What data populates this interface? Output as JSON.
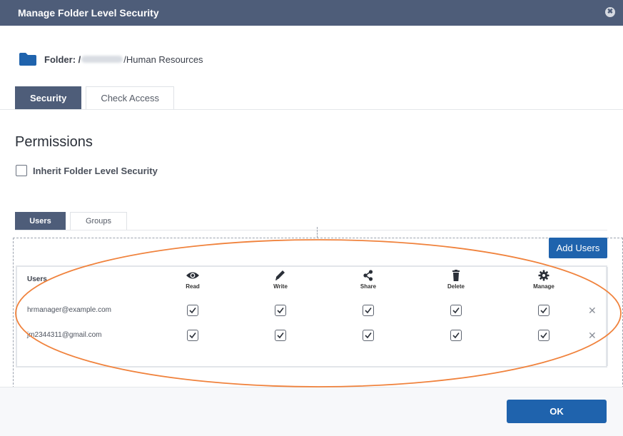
{
  "dialog": {
    "title": "Manage Folder Level Security",
    "close_symbol": "✖"
  },
  "folder": {
    "label": "Folder: /",
    "path_suffix": "/Human Resources",
    "icon": "folder-icon",
    "icon_color": "#1f63ad"
  },
  "tabs": {
    "security": "Security",
    "check_access": "Check Access"
  },
  "permissions": {
    "title": "Permissions",
    "inherit_label": "Inherit Folder Level Security",
    "inherit_checked": false
  },
  "subtabs": {
    "users": "Users",
    "groups": "Groups"
  },
  "add_users_label": "Add Users",
  "grid": {
    "users_header": "Users",
    "columns": [
      {
        "label": "Read",
        "icon": "eye-icon"
      },
      {
        "label": "Write",
        "icon": "pencil-icon"
      },
      {
        "label": "Share",
        "icon": "share-icon"
      },
      {
        "label": "Delete",
        "icon": "trash-icon"
      },
      {
        "label": "Manage",
        "icon": "gear-icon"
      }
    ],
    "rows": [
      {
        "email": "hrmanager@example.com",
        "read": true,
        "write": true,
        "share": true,
        "delete": true,
        "manage": true
      },
      {
        "email": "jm2344311@gmail.com",
        "read": true,
        "write": true,
        "share": true,
        "delete": true,
        "manage": true
      }
    ]
  },
  "remove_symbol": "✕",
  "ok_label": "OK",
  "colors": {
    "header_bg": "#4e5d79",
    "primary": "#1f63ad",
    "annotation": "#f0823c"
  }
}
